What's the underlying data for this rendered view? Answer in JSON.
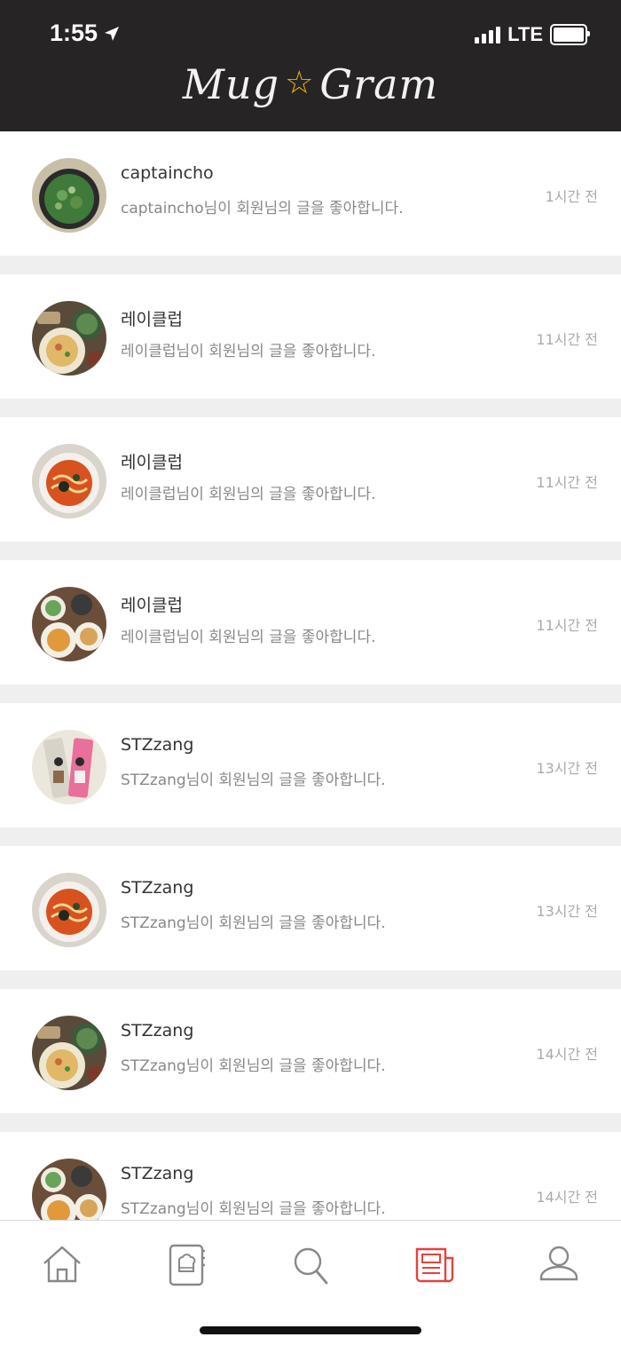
{
  "status_bar": {
    "time": "1:55",
    "network": "LTE"
  },
  "header": {
    "logo_left": "Mug",
    "logo_right": "Gram"
  },
  "notifications": [
    {
      "name": "captaincho",
      "message": "captaincho님이 회원님의 글을 좋아합니다.",
      "time": "1시간 전",
      "thumb": "green-soup"
    },
    {
      "name": "레이클럽",
      "message": "레이클럽님이 회원님의 글을 좋아합니다.",
      "time": "11시간 전",
      "thumb": "meal-spread"
    },
    {
      "name": "레이클럽",
      "message": "레이클럽님이 회원님의 글을 좋아합니다.",
      "time": "11시간 전",
      "thumb": "ramen"
    },
    {
      "name": "레이클럽",
      "message": "레이클럽님이 회원님의 글을 좋아합니다.",
      "time": "11시간 전",
      "thumb": "table-dishes"
    },
    {
      "name": "STZzang",
      "message": "STZzang님이 회원님의 글을 좋아합니다.",
      "time": "13시간 전",
      "thumb": "packages"
    },
    {
      "name": "STZzang",
      "message": "STZzang님이 회원님의 글을 좋아합니다.",
      "time": "13시간 전",
      "thumb": "ramen"
    },
    {
      "name": "STZzang",
      "message": "STZzang님이 회원님의 글을 좋아합니다.",
      "time": "14시간 전",
      "thumb": "meal-spread"
    },
    {
      "name": "STZzang",
      "message": "STZzang님이 회원님의 글을 좋아합니다.",
      "time": "14시간 전",
      "thumb": "table-dishes"
    }
  ],
  "tabbar": {
    "items": [
      {
        "icon": "home-icon",
        "active": false
      },
      {
        "icon": "recipe-book-icon",
        "active": false
      },
      {
        "icon": "search-icon",
        "active": false
      },
      {
        "icon": "news-icon",
        "active": true
      },
      {
        "icon": "profile-icon",
        "active": false
      }
    ],
    "active_color": "#e8413c",
    "inactive_color": "#888888"
  },
  "colors": {
    "header_bg": "#262424",
    "logo_star": "#f0b400",
    "divider": "#efefef"
  }
}
